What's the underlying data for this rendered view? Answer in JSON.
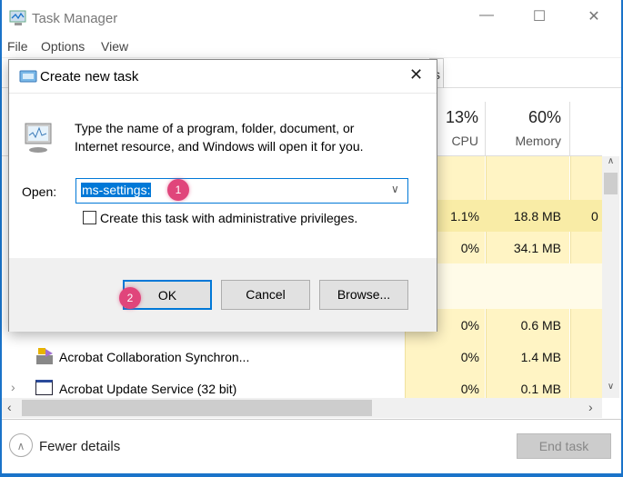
{
  "window": {
    "title": "Task Manager",
    "minimize": "—",
    "maximize": "☐",
    "close": "✕"
  },
  "menu": [
    "File",
    "Options",
    "View"
  ],
  "tab_partial": "s",
  "columns": {
    "cpu": {
      "pct": "13%",
      "label": "CPU"
    },
    "memory": {
      "pct": "60%",
      "label": "Memory"
    }
  },
  "rows": [
    {
      "name": "",
      "cpu": "1.1%",
      "memory": "18.8 MB",
      "extra": "0"
    },
    {
      "name": "",
      "cpu": "0%",
      "memory": "34.1 MB",
      "extra": ""
    },
    {
      "name": "",
      "cpu": "",
      "memory": "",
      "extra": ""
    },
    {
      "name": "",
      "cpu": "0%",
      "memory": "0.6 MB",
      "extra": ""
    },
    {
      "name": "Acrobat Collaboration Synchron...",
      "cpu": "0%",
      "memory": "1.4 MB",
      "extra": ""
    },
    {
      "name": "Acrobat Update Service (32 bit)",
      "cpu": "0%",
      "memory": "0.1 MB",
      "extra": ""
    }
  ],
  "footer": {
    "fewer_details": "Fewer details",
    "end_task": "End task"
  },
  "dialog": {
    "title": "Create new task",
    "description_line1": "Type the name of a program, folder, document, or",
    "description_line2": "Internet resource, and Windows will open it for you.",
    "open_label": "Open:",
    "open_value": "ms-settings:",
    "checkbox_label": "Create this task with administrative privileges.",
    "checkbox_checked": false,
    "ok": "OK",
    "cancel": "Cancel",
    "browse": "Browse..."
  },
  "annotations": [
    "1",
    "2"
  ],
  "colors": {
    "accent": "#0078d7",
    "badge": "#e0457b",
    "cpu_col": "#fff4c4",
    "highlight_row": "#f9eca6"
  }
}
